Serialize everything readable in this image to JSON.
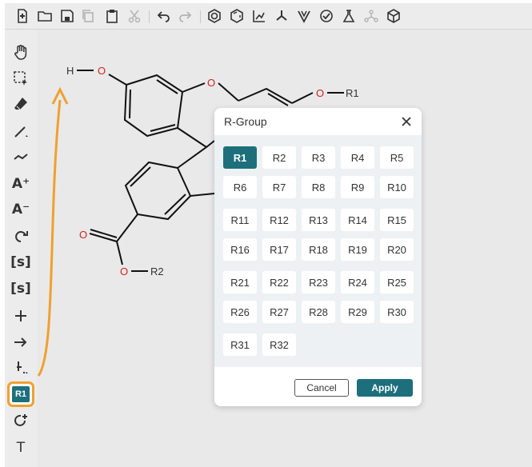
{
  "toolbar": {
    "icons": [
      "new-file-icon",
      "open-folder-icon",
      "save-icon",
      "copy-icon",
      "paste-icon",
      "cut-icon",
      "undo-icon",
      "redo-icon",
      "aromatize-icon",
      "dearomatize-icon",
      "layout-icon",
      "clean-icon",
      "calculate-cip-icon",
      "check-structure-icon",
      "analyse-icon",
      "stereo-icon",
      "3d-viewer-icon"
    ]
  },
  "left_toolbar": {
    "erase_hint": "",
    "charge_plus": "A⁺",
    "charge_minus": "A⁻",
    "sgroup": "[s]",
    "sgroup_plus": "[s]",
    "rgroup_label": "R1",
    "text_tool": "T"
  },
  "molecule": {
    "atoms": {
      "h": "H",
      "o_hydroxyl": "O",
      "o_ring": "O",
      "o_ether": "O",
      "r1": "R1",
      "o_carbonyl": "O",
      "o_ester": "O",
      "r2": "R2"
    }
  },
  "dialog": {
    "title": "R-Group",
    "selected": "R1",
    "options": [
      "R1",
      "R2",
      "R3",
      "R4",
      "R5",
      "R6",
      "R7",
      "R8",
      "R9",
      "R10",
      "R11",
      "R12",
      "R13",
      "R14",
      "R15",
      "R16",
      "R17",
      "R18",
      "R19",
      "R20",
      "R21",
      "R22",
      "R23",
      "R24",
      "R25",
      "R26",
      "R27",
      "R28",
      "R29",
      "R30",
      "R31",
      "R32"
    ],
    "cancel_label": "Cancel",
    "apply_label": "Apply"
  },
  "colors": {
    "accent": "#1d6f7c",
    "highlight": "#f0a030",
    "oxygen": "#d42020"
  }
}
